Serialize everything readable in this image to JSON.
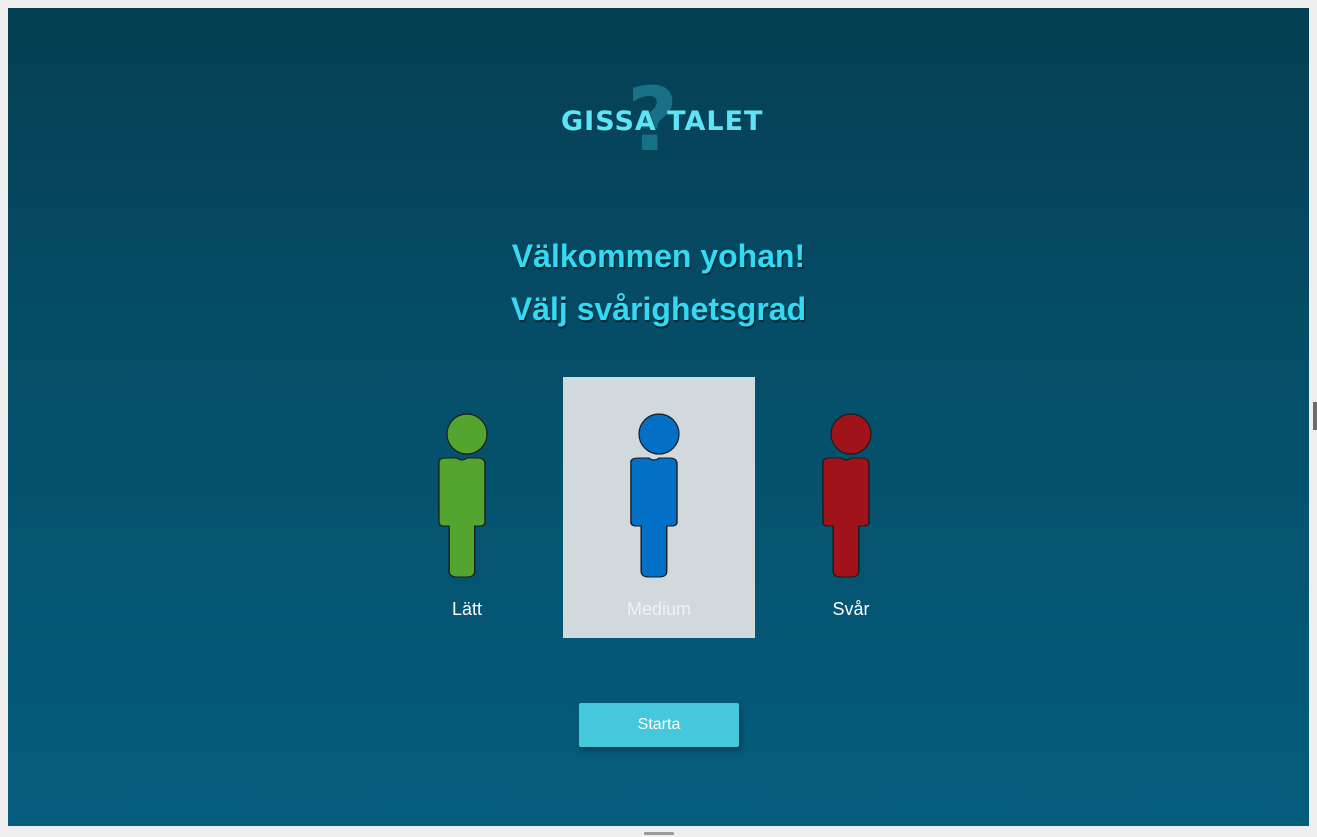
{
  "logo": {
    "text": "GISSA TALET",
    "mark": "?"
  },
  "heading": {
    "welcome": "Välkommen yohan!",
    "choose": "Välj svårighetsgrad"
  },
  "difficulties": [
    {
      "label": "Lätt",
      "color": "#54a430",
      "selected": false
    },
    {
      "label": "Medium",
      "color": "#0170c6",
      "selected": true
    },
    {
      "label": "Svår",
      "color": "#a0131a",
      "selected": false
    }
  ],
  "start_button": {
    "label": "Starta"
  },
  "colors": {
    "background_top": "#053f53",
    "background_bottom": "#055d7d",
    "heading": "#34d9f3",
    "selected_tile": "#d2d9dd",
    "button": "#45c8dc"
  }
}
